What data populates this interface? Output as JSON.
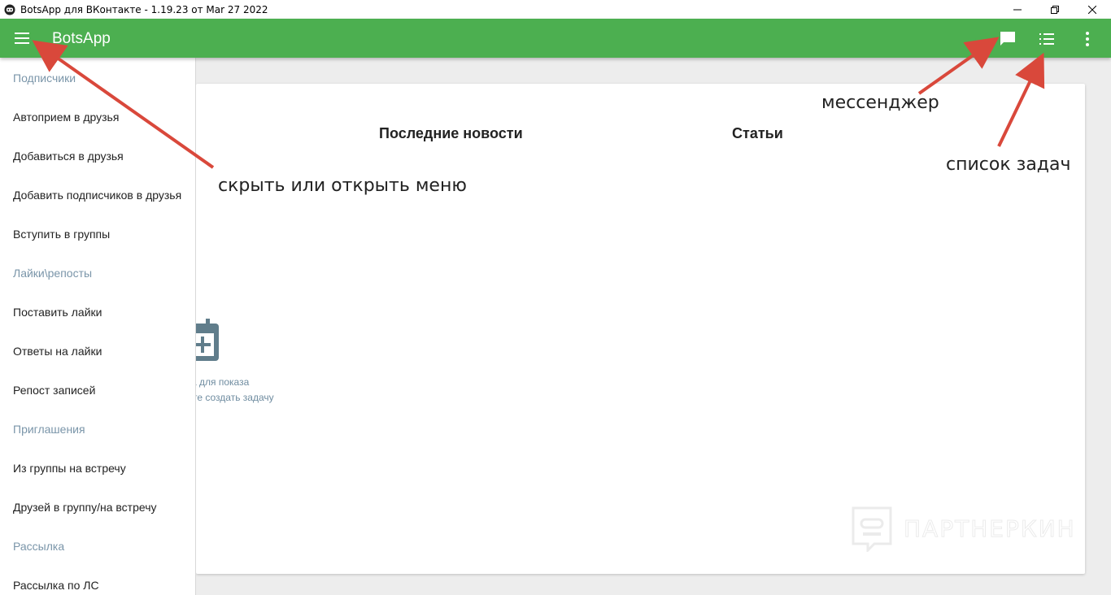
{
  "window": {
    "title": "BotsApp для ВКонтакте - 1.19.23 от Mar 27 2022",
    "controls": {
      "minimize_icon": "minimize-icon",
      "restore_icon": "restore-icon",
      "close_icon": "close-icon"
    }
  },
  "appbar": {
    "title": "BotsApp",
    "color": "#4caf50",
    "menu_icon": "hamburger-icon",
    "messenger_icon": "chat-icon",
    "tasks_icon": "list-icon",
    "more_icon": "more-vertical-icon"
  },
  "drawer": {
    "sections": {
      "subscribers": "Подписчики",
      "likes": "Лайки\\репосты",
      "invites": "Приглашения",
      "mailing": "Рассылка"
    },
    "items": {
      "auto_accept": "Автоприем в друзья",
      "add_friends": "Добавиться в друзья",
      "add_subscribers": "Добавить подписчиков в друзья",
      "join_groups": "Вступить в группы",
      "put_likes": "Поставить лайки",
      "like_answers": "Ответы на лайки",
      "repost": "Репост записей",
      "group_to_event": "Из группы на встречу",
      "friends_to_group": "Друзей в группу/на встречу",
      "pm_mailing": "Рассылка по ЛС"
    }
  },
  "main": {
    "tabs": {
      "news": "Последние новости",
      "articles": "Статьи"
    },
    "empty_state": {
      "icon": "calendar-add-icon",
      "line1": "а для показа",
      "line2": "те создать задачу"
    },
    "watermark": {
      "icon": "partnerkin-logo-icon",
      "text": "ПАРТНЕРКИН"
    }
  },
  "annotations": {
    "menu": "скрыть или открыть меню",
    "messenger": "мессенджер",
    "tasks": "список задач",
    "arrow_color": "#d9483b"
  }
}
